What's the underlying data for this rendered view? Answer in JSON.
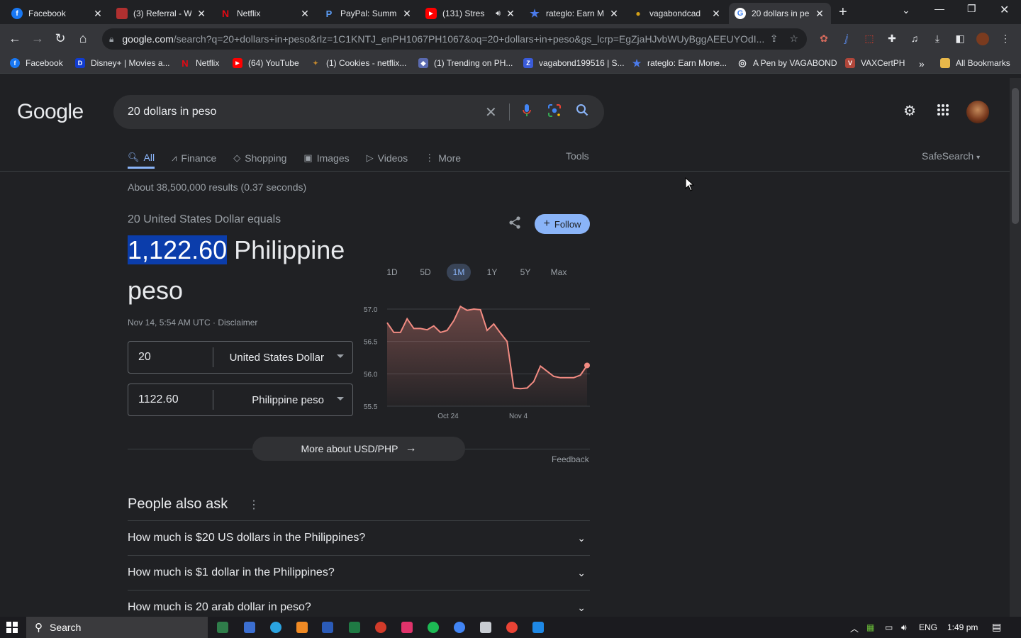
{
  "browser": {
    "tabs": [
      {
        "title": "Facebook",
        "icon": "facebook-icon",
        "color": "#1877f2",
        "glyph": "f"
      },
      {
        "title": "(3) Referral - W",
        "icon": "shield-icon",
        "color": "#b03030",
        "glyph": ""
      },
      {
        "title": "Netflix",
        "icon": "netflix-icon",
        "color": "#e50914",
        "glyph": "N"
      },
      {
        "title": "PayPal: Summ",
        "icon": "paypal-icon",
        "color": "#2b6cd4",
        "glyph": "P"
      },
      {
        "title": "(131) Stres",
        "icon": "youtube-icon",
        "color": "#ff0000",
        "glyph": "▶"
      },
      {
        "title": "rateglo: Earn M",
        "icon": "star-icon",
        "color": "#4b7bec",
        "glyph": "★"
      },
      {
        "title": "vagabondcad",
        "icon": "paw-icon",
        "color": "#d4a017",
        "glyph": "●"
      },
      {
        "title": "20 dollars in pe",
        "icon": "google-icon",
        "color": "#ffffff",
        "glyph": "G"
      }
    ],
    "new_tab": "+",
    "address": {
      "host": "google.com",
      "rest": "/search?q=20+dollars+in+peso&rlz=1C1KNTJ_enPH1067PH1067&oq=20+dollars+in+peso&gs_lcrp=EgZjaHJvbWUyBggAEEUYOdI..."
    },
    "bookmarks": [
      {
        "label": "Facebook",
        "color": "#1877f2",
        "glyph": "f"
      },
      {
        "label": "Disney+ | Movies a...",
        "color": "#113ccf",
        "glyph": "D"
      },
      {
        "label": "Netflix",
        "color": "#e50914",
        "glyph": "N"
      },
      {
        "label": "(64) YouTube",
        "color": "#ff0000",
        "glyph": "▶"
      },
      {
        "label": "(1) Cookies - netflix...",
        "color": "#c68a2e",
        "glyph": "🍪"
      },
      {
        "label": "(1) Trending on PH...",
        "color": "#5a6ab0",
        "glyph": "◆"
      },
      {
        "label": "vagabond199516 | S...",
        "color": "#3a5bd9",
        "glyph": "Z"
      },
      {
        "label": "rateglo: Earn Mone...",
        "color": "#4b7bec",
        "glyph": "★"
      },
      {
        "label": "A Pen by VAGABOND",
        "color": "#444444",
        "glyph": "◎"
      },
      {
        "label": "VAXCertPH",
        "color": "#b0463a",
        "glyph": "V"
      }
    ],
    "bookmarks_overflow": "»",
    "all_bookmarks": "All Bookmarks"
  },
  "google": {
    "logo": "Google",
    "query": "20 dollars in peso",
    "tabs": [
      {
        "label": "All",
        "icon": "search-icon",
        "glyph": "🔍︎"
      },
      {
        "label": "Finance",
        "icon": "finance-icon",
        "glyph": "⛉"
      },
      {
        "label": "Shopping",
        "icon": "tag-icon",
        "glyph": "◇"
      },
      {
        "label": "Images",
        "icon": "image-icon",
        "glyph": "▣"
      },
      {
        "label": "Videos",
        "icon": "video-icon",
        "glyph": "▷"
      },
      {
        "label": "More",
        "icon": "more-vert-icon",
        "glyph": "⋮"
      }
    ],
    "tools": "Tools",
    "safesearch": "SafeSearch",
    "stats": "About 38,500,000 results (0.37 seconds)"
  },
  "converter": {
    "equals_label": "20 United States Dollar equals",
    "result_value": "1,122.60",
    "result_unit": "Philippine peso",
    "date": "Nov 14, 5:54 AM UTC",
    "separator": " · ",
    "disclaimer": "Disclaimer",
    "follow": "Follow",
    "from": {
      "amount": "20",
      "currency": "United States Dollar"
    },
    "to": {
      "amount": "1122.60",
      "currency": "Philippine peso"
    },
    "ranges": [
      "1D",
      "5D",
      "1M",
      "1Y",
      "5Y",
      "Max"
    ],
    "active_range": "1M",
    "more_about": "More about USD/PHP",
    "feedback": "Feedback"
  },
  "chart_data": {
    "type": "line",
    "title": "",
    "xlabel": "",
    "ylabel": "",
    "ylim": [
      55.5,
      57.0
    ],
    "yticks": [
      57.0,
      56.5,
      56.0,
      55.5
    ],
    "xticks": [
      "Oct 24",
      "Nov 4"
    ],
    "line_color": "#f28b82",
    "values": [
      56.79,
      56.64,
      56.64,
      56.85,
      56.7,
      56.7,
      56.68,
      56.74,
      56.64,
      56.67,
      56.82,
      57.04,
      56.98,
      57.0,
      56.99,
      56.67,
      56.77,
      56.63,
      56.5,
      55.78,
      55.77,
      55.78,
      55.88,
      56.12,
      56.04,
      55.96,
      55.94,
      55.94,
      55.94,
      55.98,
      56.13
    ]
  },
  "people_also_ask": {
    "title": "People also ask",
    "questions": [
      "How much is $20 US dollars in the Philippines?",
      "How much is $1 dollar in the Philippines?",
      "How much is 20 arab dollar in peso?"
    ]
  },
  "taskbar": {
    "search": "Search",
    "language": "ENG",
    "time": "1:49 pm"
  }
}
